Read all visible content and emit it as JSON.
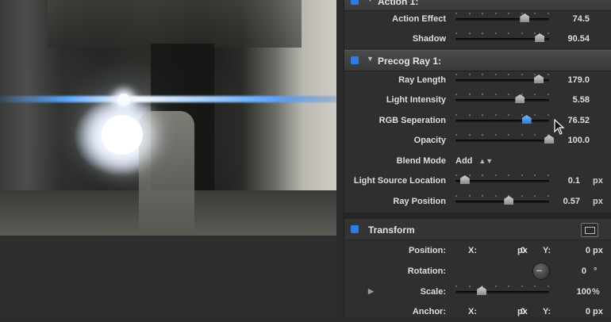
{
  "viewer": {
    "description_icon": "video-frame"
  },
  "inspector": {
    "top_header": {
      "title": "Action 1:"
    },
    "action_rows": [
      {
        "label": "Action Effect",
        "value": "74.5",
        "fraction": 0.74
      },
      {
        "label": "Shadow",
        "value": "90.54",
        "fraction": 0.9
      }
    ],
    "precog": {
      "title": "Precog Ray 1:",
      "rows": [
        {
          "label": "Ray Length",
          "value": "179.0",
          "fraction": 0.89
        },
        {
          "label": "Light Intensity",
          "value": "5.58",
          "fraction": 0.69
        },
        {
          "label": "RGB Seperation",
          "value": "76.52",
          "fraction": 0.76
        },
        {
          "label": "Opacity",
          "value": "100.0",
          "fraction": 1.0
        }
      ],
      "blend_mode": {
        "label": "Blend Mode",
        "value": "Add"
      },
      "light_source": {
        "label": "Light Source Location",
        "value": "0.1",
        "unit": "px",
        "fraction": 0.1
      },
      "ray_position": {
        "label": "Ray Position",
        "value": "0.57",
        "unit": "px",
        "fraction": 0.57
      }
    },
    "transform": {
      "title": "Transform",
      "position": {
        "label": "Position:",
        "x_label": "X:",
        "x_value": "0",
        "x_unit": "px",
        "y_label": "Y:",
        "y_value": "0",
        "y_unit": "px"
      },
      "rotation": {
        "label": "Rotation:",
        "value": "0",
        "unit": "°"
      },
      "scale": {
        "label": "Scale:",
        "value": "100",
        "unit": "%",
        "fraction": 0.28
      },
      "anchor": {
        "label": "Anchor:",
        "x_label": "X:",
        "x_value": "0",
        "x_unit": "px",
        "y_label": "Y:",
        "y_value": "0",
        "y_unit": "px"
      }
    }
  },
  "colors": {
    "accent": "#2b7ce6",
    "panel": "#2f2f2f",
    "active_thumb": "#4a96f0"
  }
}
